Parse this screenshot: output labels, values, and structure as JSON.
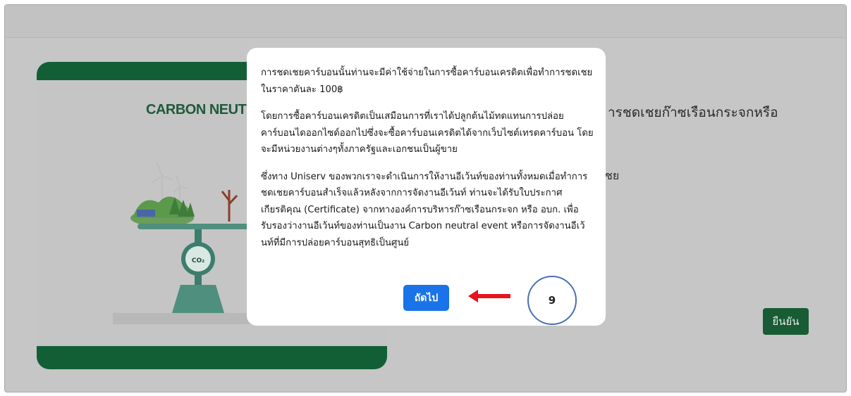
{
  "background": {
    "card_title": "CARBON NEUT",
    "heading": "ารชดเชยก๊าซเรือนกระจกหรือ",
    "subtext": "ชย",
    "confirm_label": "ยืนยัน",
    "co2_label": "CO₂"
  },
  "modal": {
    "paragraphs": [
      "การชดเชยคาร์บอนนั้นท่านจะมีค่าใช้จ่ายในการซื้อคาร์บอนเครดิตเพื่อทำการชดเชย ในราคาตันละ 100฿",
      "โดยการซื้อคาร์บอนเครดิตเป็นเสมือนการที่เราได้ปลูกต้นไม้ทดแทนการปล่อยคาร์บอนไดออกไซด์ออกไปซึ่งจะซื้อคาร์บอนเครดิตได้จากเว็บไซต์เทรดคาร์บอน โดยจะมีหน่วยงานต่างๆทั้งภาครัฐและเอกชนเป็นผู้ขาย",
      "ซึ่งทาง Uniserv ของพวกเราจะดำเนินการให้งานอีเว้นท์ของท่านทั้งหมดเมื่อทำการชดเชยคาร์บอนสำเร็จแล้วหลังจากการจัดงานอีเว้นท์ ท่านจะได้รับใบประกาศเกียรติคุณ (Certificate) จากทางองค์การบริหารก๊าซเรือนกระจก หรือ อบก. เพื่อรับรองว่างานอีเว้นท์ของท่านเป็นงาน Carbon neutral event หรือการจัดงานอีเว้นท์ที่มีการปล่อยคาร์บอนสุทธิเป็นศูนย์"
    ],
    "next_label": "ถัดไป"
  },
  "annotation": {
    "step_number": "9",
    "arrow_color": "#e8141c",
    "circle_color": "#4a6fb5"
  },
  "colors": {
    "brand_green": "#125f36",
    "primary_blue": "#1a73e8"
  }
}
